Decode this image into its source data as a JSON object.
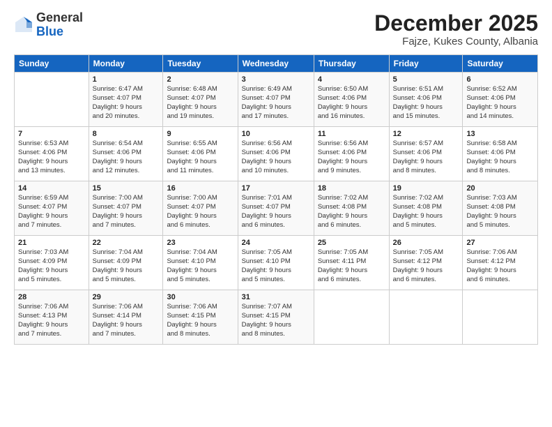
{
  "logo": {
    "general": "General",
    "blue": "Blue"
  },
  "header": {
    "month": "December 2025",
    "location": "Fajze, Kukes County, Albania"
  },
  "days_of_week": [
    "Sunday",
    "Monday",
    "Tuesday",
    "Wednesday",
    "Thursday",
    "Friday",
    "Saturday"
  ],
  "weeks": [
    [
      {
        "day": "",
        "info": ""
      },
      {
        "day": "1",
        "info": "Sunrise: 6:47 AM\nSunset: 4:07 PM\nDaylight: 9 hours\nand 20 minutes."
      },
      {
        "day": "2",
        "info": "Sunrise: 6:48 AM\nSunset: 4:07 PM\nDaylight: 9 hours\nand 19 minutes."
      },
      {
        "day": "3",
        "info": "Sunrise: 6:49 AM\nSunset: 4:07 PM\nDaylight: 9 hours\nand 17 minutes."
      },
      {
        "day": "4",
        "info": "Sunrise: 6:50 AM\nSunset: 4:06 PM\nDaylight: 9 hours\nand 16 minutes."
      },
      {
        "day": "5",
        "info": "Sunrise: 6:51 AM\nSunset: 4:06 PM\nDaylight: 9 hours\nand 15 minutes."
      },
      {
        "day": "6",
        "info": "Sunrise: 6:52 AM\nSunset: 4:06 PM\nDaylight: 9 hours\nand 14 minutes."
      }
    ],
    [
      {
        "day": "7",
        "info": "Sunrise: 6:53 AM\nSunset: 4:06 PM\nDaylight: 9 hours\nand 13 minutes."
      },
      {
        "day": "8",
        "info": "Sunrise: 6:54 AM\nSunset: 4:06 PM\nDaylight: 9 hours\nand 12 minutes."
      },
      {
        "day": "9",
        "info": "Sunrise: 6:55 AM\nSunset: 4:06 PM\nDaylight: 9 hours\nand 11 minutes."
      },
      {
        "day": "10",
        "info": "Sunrise: 6:56 AM\nSunset: 4:06 PM\nDaylight: 9 hours\nand 10 minutes."
      },
      {
        "day": "11",
        "info": "Sunrise: 6:56 AM\nSunset: 4:06 PM\nDaylight: 9 hours\nand 9 minutes."
      },
      {
        "day": "12",
        "info": "Sunrise: 6:57 AM\nSunset: 4:06 PM\nDaylight: 9 hours\nand 8 minutes."
      },
      {
        "day": "13",
        "info": "Sunrise: 6:58 AM\nSunset: 4:06 PM\nDaylight: 9 hours\nand 8 minutes."
      }
    ],
    [
      {
        "day": "14",
        "info": "Sunrise: 6:59 AM\nSunset: 4:07 PM\nDaylight: 9 hours\nand 7 minutes."
      },
      {
        "day": "15",
        "info": "Sunrise: 7:00 AM\nSunset: 4:07 PM\nDaylight: 9 hours\nand 7 minutes."
      },
      {
        "day": "16",
        "info": "Sunrise: 7:00 AM\nSunset: 4:07 PM\nDaylight: 9 hours\nand 6 minutes."
      },
      {
        "day": "17",
        "info": "Sunrise: 7:01 AM\nSunset: 4:07 PM\nDaylight: 9 hours\nand 6 minutes."
      },
      {
        "day": "18",
        "info": "Sunrise: 7:02 AM\nSunset: 4:08 PM\nDaylight: 9 hours\nand 6 minutes."
      },
      {
        "day": "19",
        "info": "Sunrise: 7:02 AM\nSunset: 4:08 PM\nDaylight: 9 hours\nand 5 minutes."
      },
      {
        "day": "20",
        "info": "Sunrise: 7:03 AM\nSunset: 4:08 PM\nDaylight: 9 hours\nand 5 minutes."
      }
    ],
    [
      {
        "day": "21",
        "info": "Sunrise: 7:03 AM\nSunset: 4:09 PM\nDaylight: 9 hours\nand 5 minutes."
      },
      {
        "day": "22",
        "info": "Sunrise: 7:04 AM\nSunset: 4:09 PM\nDaylight: 9 hours\nand 5 minutes."
      },
      {
        "day": "23",
        "info": "Sunrise: 7:04 AM\nSunset: 4:10 PM\nDaylight: 9 hours\nand 5 minutes."
      },
      {
        "day": "24",
        "info": "Sunrise: 7:05 AM\nSunset: 4:10 PM\nDaylight: 9 hours\nand 5 minutes."
      },
      {
        "day": "25",
        "info": "Sunrise: 7:05 AM\nSunset: 4:11 PM\nDaylight: 9 hours\nand 6 minutes."
      },
      {
        "day": "26",
        "info": "Sunrise: 7:05 AM\nSunset: 4:12 PM\nDaylight: 9 hours\nand 6 minutes."
      },
      {
        "day": "27",
        "info": "Sunrise: 7:06 AM\nSunset: 4:12 PM\nDaylight: 9 hours\nand 6 minutes."
      }
    ],
    [
      {
        "day": "28",
        "info": "Sunrise: 7:06 AM\nSunset: 4:13 PM\nDaylight: 9 hours\nand 7 minutes."
      },
      {
        "day": "29",
        "info": "Sunrise: 7:06 AM\nSunset: 4:14 PM\nDaylight: 9 hours\nand 7 minutes."
      },
      {
        "day": "30",
        "info": "Sunrise: 7:06 AM\nSunset: 4:15 PM\nDaylight: 9 hours\nand 8 minutes."
      },
      {
        "day": "31",
        "info": "Sunrise: 7:07 AM\nSunset: 4:15 PM\nDaylight: 9 hours\nand 8 minutes."
      },
      {
        "day": "",
        "info": ""
      },
      {
        "day": "",
        "info": ""
      },
      {
        "day": "",
        "info": ""
      }
    ]
  ]
}
